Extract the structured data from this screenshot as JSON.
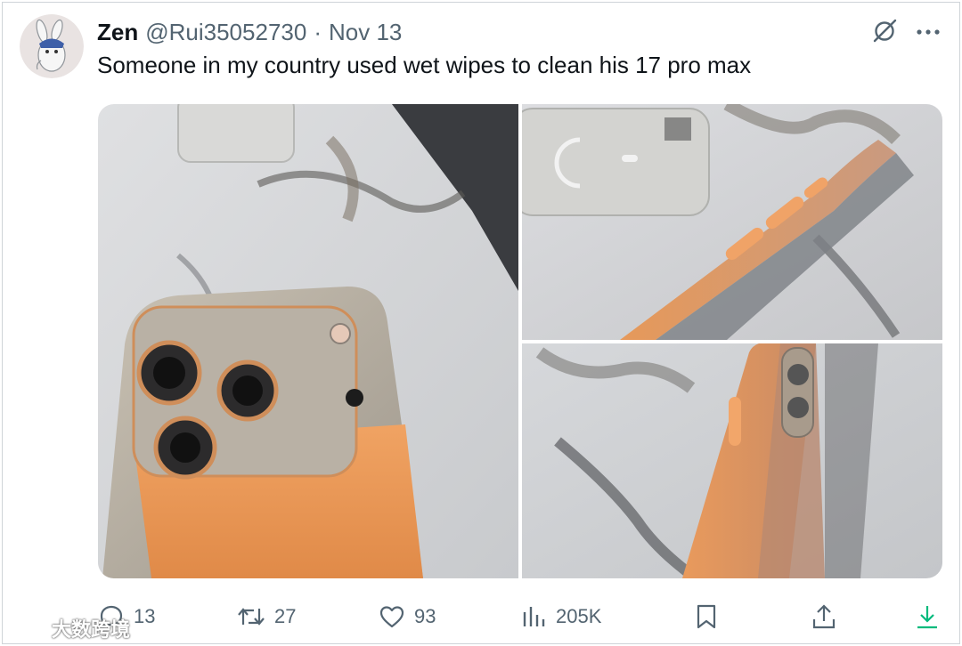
{
  "tweet": {
    "author_name": "Zen",
    "handle": "@Rui35052730",
    "separator": "·",
    "date": "Nov 13",
    "text": "Someone in my country used wet wipes to clean his 17 pro max"
  },
  "icons": {
    "grok": "grok-icon",
    "more": "more-icon",
    "reply": "reply-icon",
    "repost": "repost-icon",
    "like": "heart-icon",
    "views": "views-icon",
    "bookmark": "bookmark-icon",
    "share": "share-icon",
    "download": "download-icon"
  },
  "media": {
    "count": 3,
    "items": [
      "photo-back-cameras",
      "photo-side-buttons",
      "photo-side-frame"
    ]
  },
  "actions": {
    "replies": "13",
    "reposts": "27",
    "likes": "93",
    "views": "205K"
  },
  "watermark": {
    "text": "大数跨境"
  },
  "colors": {
    "text_primary": "#0f1419",
    "text_secondary": "#536471",
    "download_accent": "#00ba7c",
    "phone_orange": "#e79250"
  }
}
